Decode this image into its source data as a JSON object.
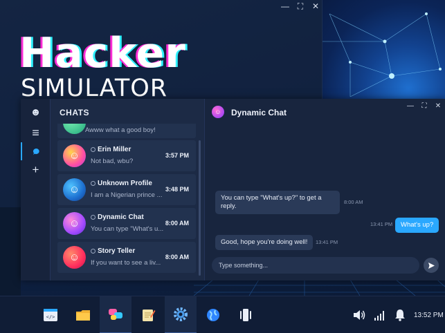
{
  "desktop": {
    "logo_line1": "Hacker",
    "logo_line2": "SIMULATOR",
    "bg_window_controls": [
      "—",
      "⛶",
      "✕"
    ]
  },
  "rail": {
    "items": [
      {
        "icon": "skull-icon",
        "glyph": "☻"
      },
      {
        "icon": "menu-icon",
        "glyph": "≡"
      },
      {
        "icon": "chat-bubble-icon",
        "glyph": "●",
        "active": true
      },
      {
        "icon": "plus-icon",
        "glyph": "+"
      }
    ]
  },
  "chats": {
    "title": "CHATS",
    "partial_preview": "Awww what a good boy!",
    "items": [
      {
        "name": "Erin Miller",
        "preview": "Not bad, wbu?",
        "time": "3:57 PM"
      },
      {
        "name": "Unknown Profile",
        "preview": "I am a Nigerian prince ...",
        "time": "3:48 PM"
      },
      {
        "name": "Dynamic Chat",
        "preview": "You can type \"What's u...",
        "time": "8:00 AM"
      },
      {
        "name": "Story Teller",
        "preview": "If you want to see a liv...",
        "time": "8:00 AM"
      }
    ]
  },
  "conversation": {
    "title": "Dynamic Chat",
    "window_controls": [
      "—",
      "⛶",
      "✕"
    ],
    "messages": [
      {
        "direction": "in",
        "text": "You can type \"What's up?\" to get a reply.",
        "time": "8:00 AM"
      },
      {
        "direction": "out",
        "text": "What's up?",
        "time": "13:41 PM"
      },
      {
        "direction": "in",
        "text": "Good, hope you're doing well!",
        "time": "13:41 PM"
      }
    ],
    "composer_placeholder": "Type something..."
  },
  "taskbar": {
    "apps": [
      "code-editor-icon",
      "folder-icon",
      "chat-app-icon",
      "notes-icon",
      "settings-gear-icon",
      "browser-globe-icon",
      "phone-icon"
    ],
    "tray": [
      "volume-icon",
      "signal-bars-icon",
      "bell-icon"
    ],
    "clock": "13:52 PM"
  },
  "colors": {
    "accent": "#2aa8ff",
    "panel": "#1c2a45",
    "desktop": "#0e1e3b"
  }
}
